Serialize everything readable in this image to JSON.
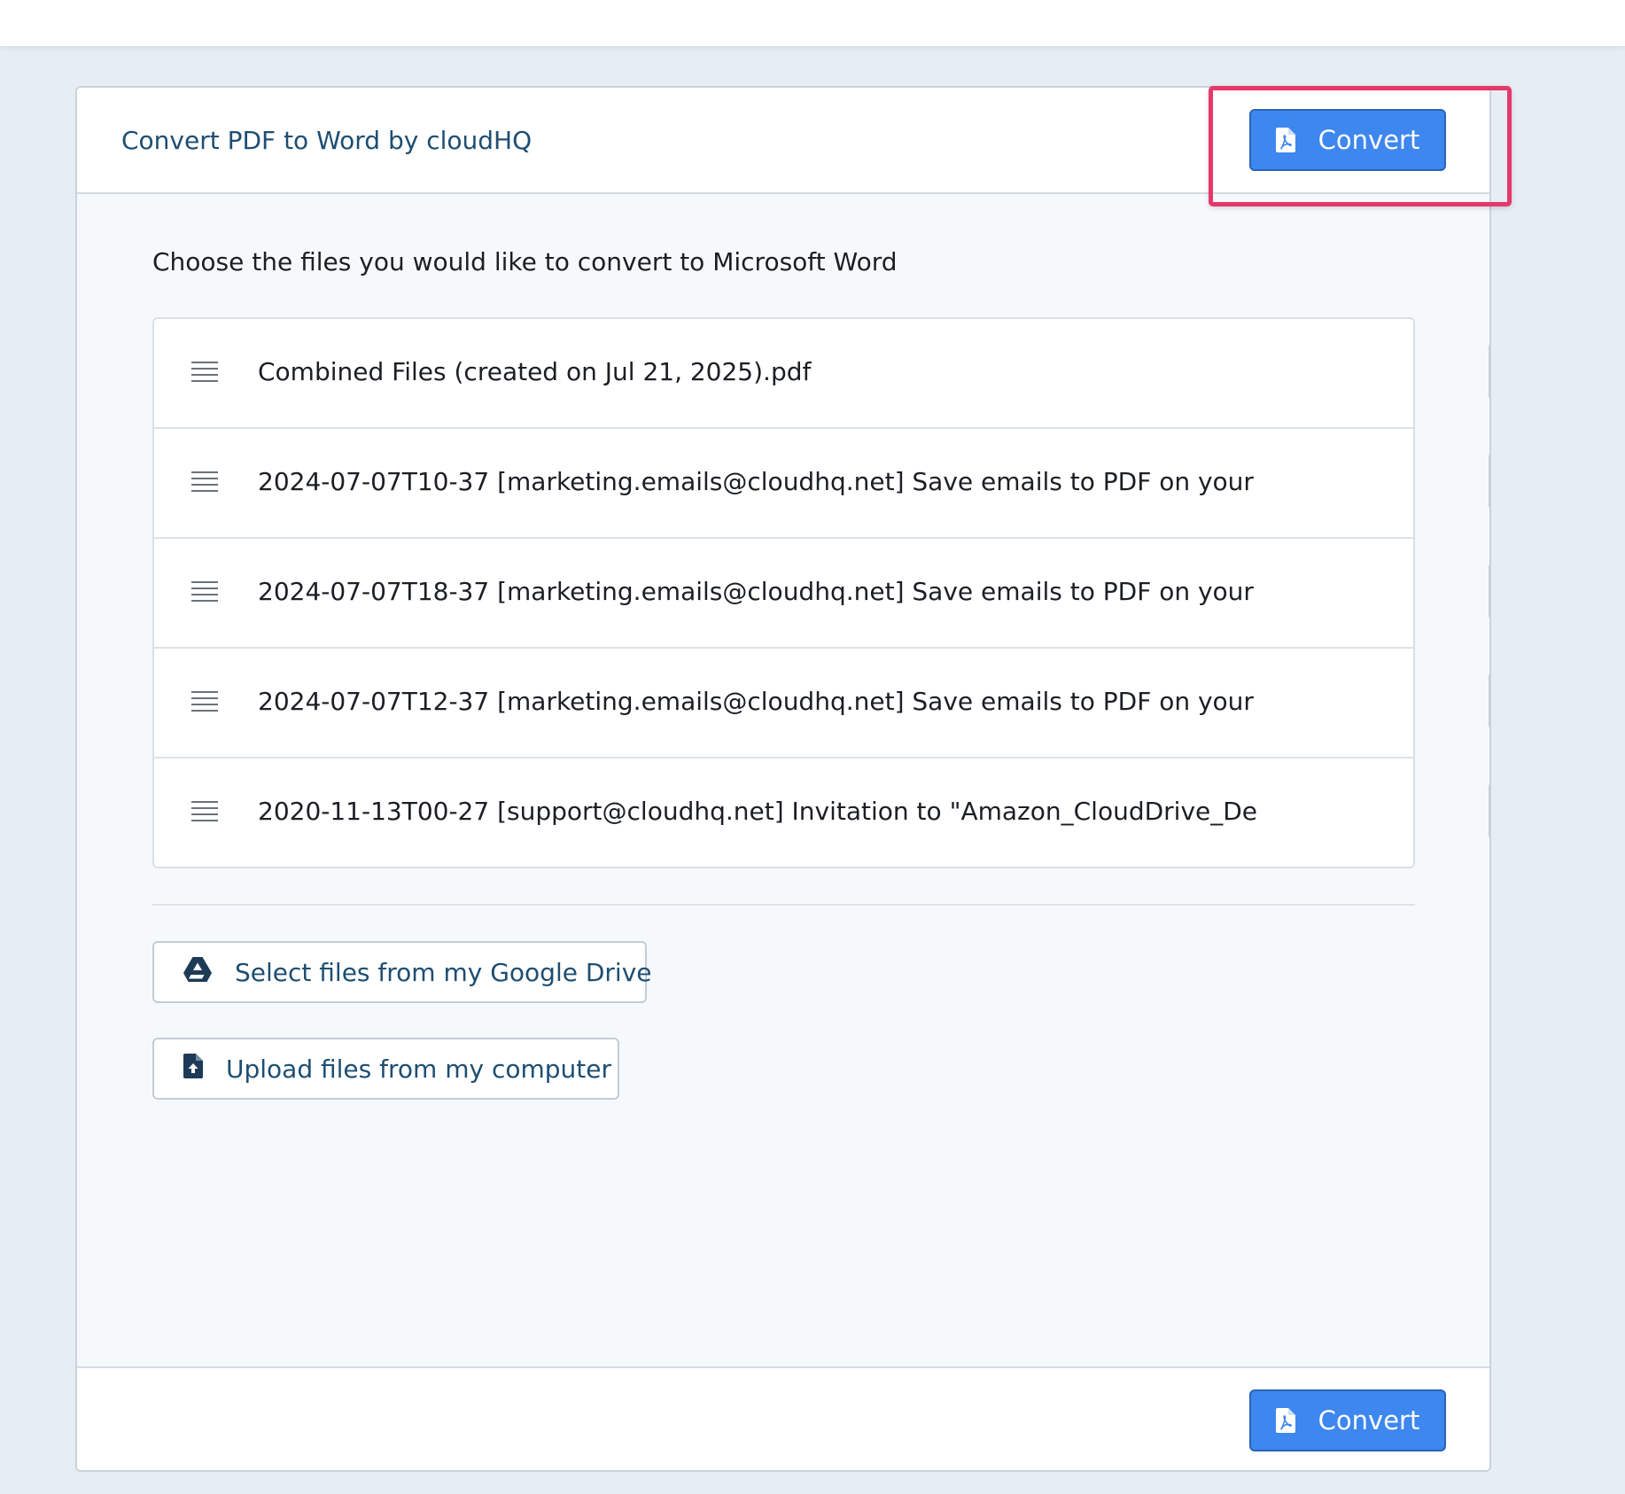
{
  "header": {
    "title": "Convert PDF to Word by cloudHQ",
    "convert_label": "Convert"
  },
  "main": {
    "instructions": "Choose the files you would like to convert to Microsoft Word",
    "files": [
      {
        "name": "Combined Files (created on Jul 21, 2025).pdf"
      },
      {
        "name": "2024-07-07T10-37 [marketing.emails@cloudhq.net] Save emails to PDF on your phone!"
      },
      {
        "name": "2024-07-07T18-37 [marketing.emails@cloudhq.net] Save emails to PDF on your phone!"
      },
      {
        "name": "2024-07-07T12-37 [marketing.emails@cloudhq.net] Save emails to PDF on your phone!"
      },
      {
        "name": "2020-11-13T00-27 [support@cloudhq.net] Invitation to \"Amazon_CloudDrive_Demo\" acc"
      }
    ],
    "google_drive_label": "Select files from my Google Drive",
    "upload_label": "Upload files from my computer"
  },
  "footer": {
    "convert_label": "Convert"
  },
  "icons": {
    "convert": "file-pdf-icon",
    "drag": "drag-handle-icon",
    "delete": "trash-icon",
    "google_drive": "google-drive-icon",
    "upload": "file-upload-icon"
  },
  "colors": {
    "primary_button": "#3d87ee",
    "title_text": "#1e4e72",
    "highlight": "#e5386b",
    "background": "#e6edf3"
  }
}
